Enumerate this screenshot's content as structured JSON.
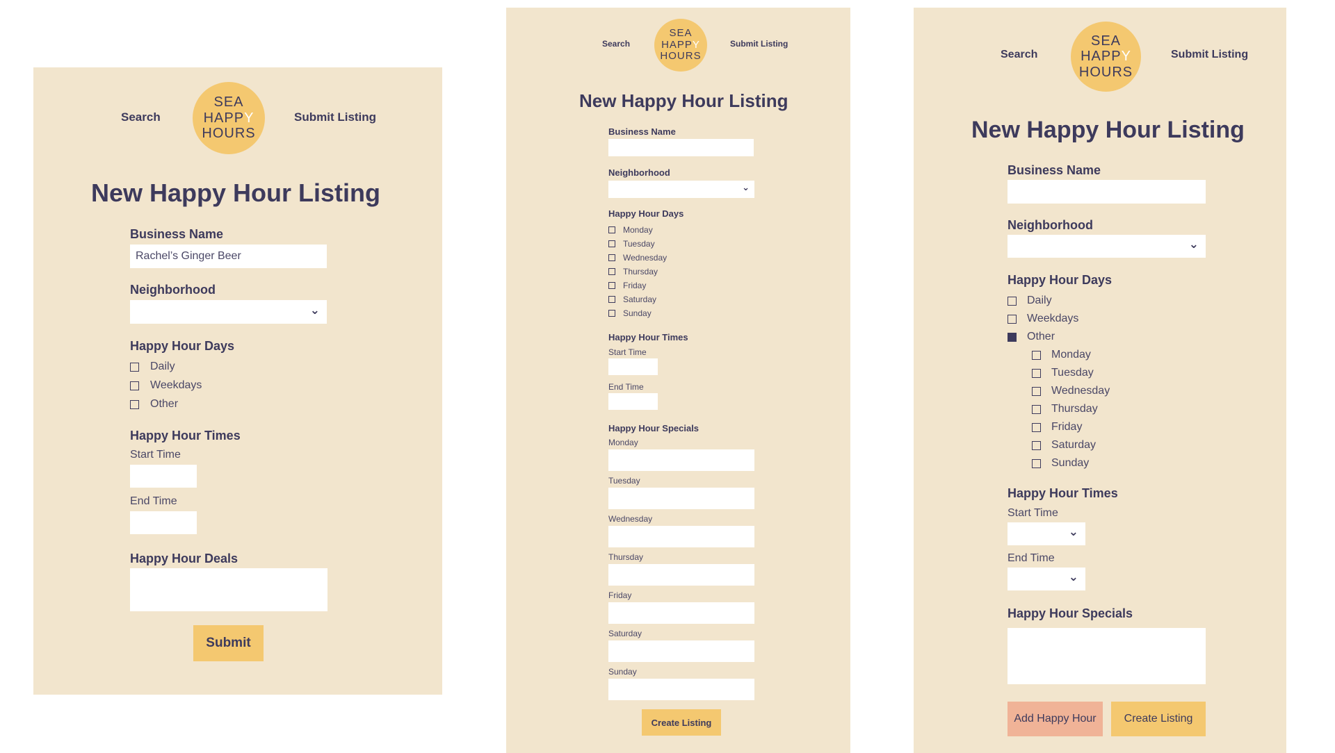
{
  "colors": {
    "panel_bg": "#f2e5cd",
    "accent_yellow": "#f4c870",
    "accent_pink": "#f0b397",
    "text_navy": "#3d3a5c"
  },
  "nav": {
    "search": "Search",
    "submit_listing": "Submit Listing",
    "logo_line1": "SEA",
    "logo_line2": "HAPP",
    "logo_glass": "Y",
    "logo_line3": "HOURS"
  },
  "form_title": "New Happy Hour Listing",
  "mockup1": {
    "business_name_label": "Business Name",
    "business_name_value": "Rachel’s Ginger Beer",
    "neighborhood_label": "Neighborhood",
    "days_label": "Happy Hour Days",
    "days": [
      "Daily",
      "Weekdays",
      "Other"
    ],
    "times_label": "Happy Hour Times",
    "start_time_label": "Start Time",
    "end_time_label": "End Time",
    "deals_label": "Happy Hour Deals",
    "submit_label": "Submit"
  },
  "mockup2": {
    "business_name_label": "Business Name",
    "neighborhood_label": "Neighborhood",
    "days_label": "Happy Hour Days",
    "days": [
      "Monday",
      "Tuesday",
      "Wednesday",
      "Thursday",
      "Friday",
      "Saturday",
      "Sunday"
    ],
    "times_label": "Happy Hour Times",
    "start_time_label": "Start Time",
    "end_time_label": "End Time",
    "specials_label": "Happy Hour Specials",
    "specials_days": [
      "Monday",
      "Tuesday",
      "Wednesday",
      "Thursday",
      "Friday",
      "Saturday",
      "Sunday"
    ],
    "create_label": "Create Listing"
  },
  "mockup3": {
    "business_name_label": "Business Name",
    "neighborhood_label": "Neighborhood",
    "days_label": "Happy Hour Days",
    "day_options": [
      {
        "label": "Daily",
        "checked": false
      },
      {
        "label": "Weekdays",
        "checked": false
      },
      {
        "label": "Other",
        "checked": true
      }
    ],
    "sub_days": [
      "Monday",
      "Tuesday",
      "Wednesday",
      "Thursday",
      "Friday",
      "Saturday",
      "Sunday"
    ],
    "times_label": "Happy Hour Times",
    "start_time_label": "Start Time",
    "end_time_label": "End Time",
    "specials_label": "Happy Hour Specials",
    "add_label": "Add Happy Hour",
    "create_label": "Create Listing"
  }
}
